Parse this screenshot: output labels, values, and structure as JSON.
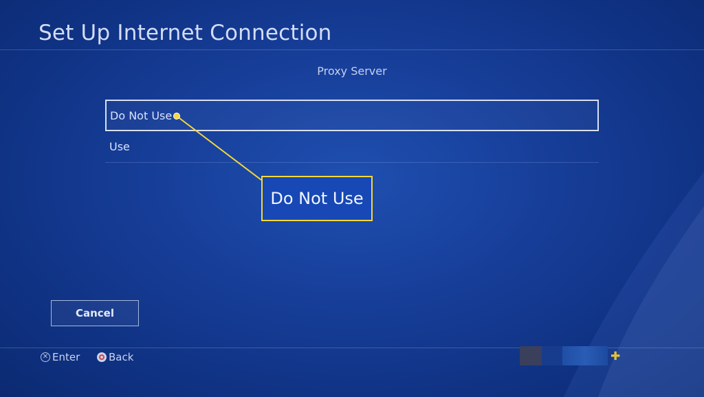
{
  "header": {
    "title": "Set Up Internet Connection"
  },
  "main": {
    "subtitle": "Proxy Server",
    "options": [
      {
        "label": "Do Not Use",
        "selected": true
      },
      {
        "label": "Use",
        "selected": false
      }
    ],
    "callout": {
      "text": "Do Not Use",
      "color": "#f5d83a"
    },
    "cancel_label": "Cancel"
  },
  "footer": {
    "hints": [
      {
        "icon": "cross-button-icon",
        "label": "Enter"
      },
      {
        "icon": "circle-button-icon",
        "label": "Back"
      }
    ],
    "plus_icon": "plus-icon"
  },
  "theme": {
    "background": "#173f9a",
    "accent": "#f5d83a"
  }
}
